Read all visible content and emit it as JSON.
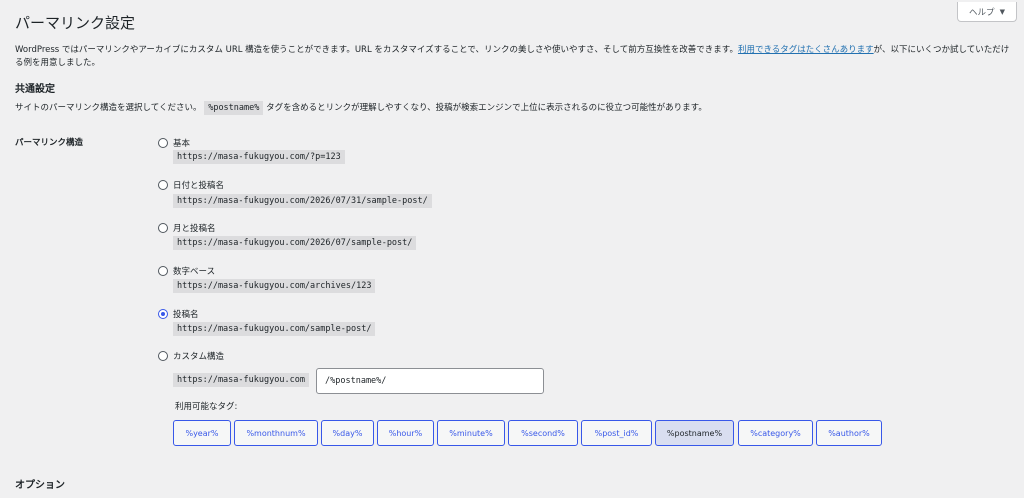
{
  "header": {
    "title": "パーマリンク設定",
    "help_label": "ヘルプ",
    "help_caret": "▼"
  },
  "intro": {
    "text_before": "WordPress ではパーマリンクやアーカイブにカスタム URL 構造を使うことができます。URL をカスタマイズすることで、リンクの美しさや使いやすさ、そして前方互換性を改善できます。",
    "link_text": "利用できるタグはたくさんあります",
    "text_after": "が、以下にいくつか試していただける例を用意しました。"
  },
  "common": {
    "title": "共通設定",
    "desc_before": "サイトのパーマリンク構造を選択してください。",
    "desc_code": "%postname%",
    "desc_after": "タグを含めるとリンクが理解しやすくなり、投稿が検索エンジンで上位に表示されるのに役立つ可能性があります。"
  },
  "structure": {
    "label": "パーマリンク構造",
    "options": [
      {
        "label": "基本",
        "example": "https://masa-fukugyou.com/?p=123"
      },
      {
        "label": "日付と投稿名",
        "example": "https://masa-fukugyou.com/2026/07/31/sample-post/"
      },
      {
        "label": "月と投稿名",
        "example": "https://masa-fukugyou.com/2026/07/sample-post/"
      },
      {
        "label": "数字ベース",
        "example": "https://masa-fukugyou.com/archives/123"
      },
      {
        "label": "投稿名",
        "example": "https://masa-fukugyou.com/sample-post/"
      },
      {
        "label": "カスタム構造",
        "example": "https://masa-fukugyou.com"
      }
    ],
    "selected": "投稿名",
    "custom_value": "/%postname%/",
    "tags_label": "利用可能なタグ:",
    "tags": [
      "%year%",
      "%monthnum%",
      "%day%",
      "%hour%",
      "%minute%",
      "%second%",
      "%post_id%",
      "%postname%",
      "%category%",
      "%author%"
    ],
    "active_tag": "%postname%"
  },
  "options_section": {
    "title": "オプション"
  },
  "colors": {
    "accent": "#3858e9",
    "link": "#2271b1",
    "background": "#f0f0f1"
  }
}
